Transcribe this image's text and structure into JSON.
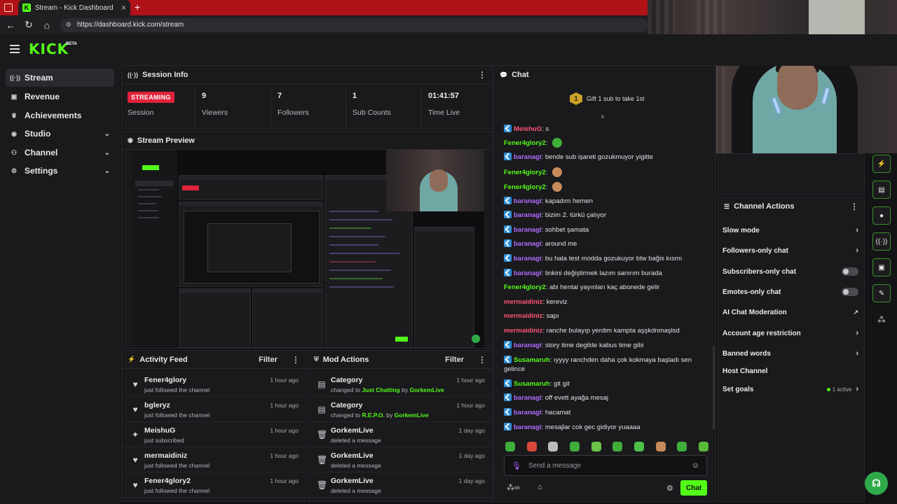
{
  "browser": {
    "tab_title": "Stream - Kick Dashboard",
    "url": "https://dashboard.kick.com/stream",
    "tab_color": "#b01217"
  },
  "brand": {
    "logo": "KICK",
    "beta": "BETA",
    "accent": "#53fc18"
  },
  "sidebar": {
    "items": [
      {
        "label": "Stream",
        "icon": "broadcast-icon",
        "active": true
      },
      {
        "label": "Revenue",
        "icon": "wallet-icon"
      },
      {
        "label": "Achievements",
        "icon": "trophy-icon"
      },
      {
        "label": "Studio",
        "icon": "camera-icon",
        "expandable": true
      },
      {
        "label": "Channel",
        "icon": "users-icon",
        "expandable": true
      },
      {
        "label": "Settings",
        "icon": "gear-icon",
        "expandable": true
      }
    ]
  },
  "session": {
    "title": "Session Info",
    "status": "STREAMING",
    "status_label": "Session",
    "stats": [
      {
        "value": "9",
        "label": "Viewers"
      },
      {
        "value": "7",
        "label": "Followers"
      },
      {
        "value": "1",
        "label": "Sub Counts"
      },
      {
        "value": "01:41:57",
        "label": "Time Live"
      }
    ]
  },
  "preview": {
    "title": "Stream Preview"
  },
  "activity": {
    "title": "Activity Feed",
    "filter": "Filter",
    "items": [
      {
        "name": "Fener4glory",
        "action": "just followed the channel",
        "time": "1 hour ago",
        "icon": "heart-icon"
      },
      {
        "name": "bgleryz",
        "action": "just followed the channel",
        "time": "1 hour ago",
        "icon": "heart-icon"
      },
      {
        "name": "MeishuG",
        "action": "just subscribed",
        "time": "1 hour ago",
        "icon": "sparkle-icon"
      },
      {
        "name": "mermaidiniz",
        "action": "just followed the channel",
        "time": "1 hour ago",
        "icon": "heart-icon"
      },
      {
        "name": "Fener4glory2",
        "action": "just followed the channel",
        "time": "1 hour ago",
        "icon": "heart-icon"
      }
    ]
  },
  "modactions": {
    "title": "Mod Actions",
    "filter": "Filter",
    "items": [
      {
        "name": "Category",
        "pre": "changed to ",
        "v1": "Just Chatting",
        "mid": " by ",
        "v2": "GorkemLive",
        "time": "1 hour ago",
        "icon": "category-icon"
      },
      {
        "name": "Category",
        "pre": "changed to ",
        "v1": "R.E.P.O.",
        "mid": " by ",
        "v2": "GorkemLive",
        "time": "1 hour ago",
        "icon": "category-icon"
      },
      {
        "name": "GorkemLive",
        "pre": "deleted a message",
        "v1": "",
        "mid": "",
        "v2": "",
        "time": "1 day ago",
        "icon": "trash-icon"
      },
      {
        "name": "GorkemLive",
        "pre": "deleted a message",
        "v1": "",
        "mid": "",
        "v2": "",
        "time": "1 day ago",
        "icon": "trash-icon"
      },
      {
        "name": "GorkemLive",
        "pre": "deleted a message",
        "v1": "",
        "mid": "",
        "v2": "",
        "time": "1 day ago",
        "icon": "trash-icon"
      }
    ]
  },
  "chat": {
    "title": "Chat",
    "gift_count": "1",
    "gift_text": "Gift 1 sub to take 1st",
    "placeholder": "Send a message",
    "send_label": "Chat",
    "messages": [
      {
        "user": "MeishuG",
        "color": "#ff5577",
        "badge": true,
        "text": "s"
      },
      {
        "user": "Fener4glory2",
        "color": "#53fc18",
        "badge": false,
        "text": "",
        "emote": "#3fae3a"
      },
      {
        "user": "baranagi",
        "color": "#b06cff",
        "badge": true,
        "text": "bende sub işareti gozukmuyor yigitte"
      },
      {
        "user": "Fener4glory2",
        "color": "#53fc18",
        "badge": false,
        "text": "",
        "emote": "#c98a5a"
      },
      {
        "user": "Fener4glory2",
        "color": "#53fc18",
        "badge": false,
        "text": "",
        "emote": "#c98a5a"
      },
      {
        "user": "baranagi",
        "color": "#b06cff",
        "badge": true,
        "text": "kapadım hemen"
      },
      {
        "user": "baranagi",
        "color": "#b06cff",
        "badge": true,
        "text": "bizim 2. türkü çalıyor"
      },
      {
        "user": "baranagi",
        "color": "#b06cff",
        "badge": true,
        "text": "sohbet şamata"
      },
      {
        "user": "baranagi",
        "color": "#b06cff",
        "badge": true,
        "text": "around me"
      },
      {
        "user": "baranagi",
        "color": "#b06cff",
        "badge": true,
        "text": "bu hala test modda gozukuyor btw bağis kısmı"
      },
      {
        "user": "baranagi",
        "color": "#b06cff",
        "badge": true,
        "text": "linkini değiştirmek lazım sanırım burada"
      },
      {
        "user": "Fener4glory2",
        "color": "#53fc18",
        "badge": false,
        "text": "abi hentai yayınları kaç abonede gelir"
      },
      {
        "user": "mermaidiniz",
        "color": "#ff5577",
        "badge": false,
        "text": "kereviz"
      },
      {
        "user": "mermaidiniz",
        "color": "#ff5577",
        "badge": false,
        "text": "sapı"
      },
      {
        "user": "mermaidiniz",
        "color": "#ff5577",
        "badge": false,
        "text": "ranche bulayıp yerdim kampta aşşkdnmaşlsd"
      },
      {
        "user": "baranagi",
        "color": "#b06cff",
        "badge": true,
        "text": "story time degilde kabus time gibi"
      },
      {
        "user": "Susamaruh",
        "color": "#53fc18",
        "badge": true,
        "text": "ıyyyy ranchden daha çok kokmaya başladı sen gelince"
      },
      {
        "user": "Susamaruh",
        "color": "#53fc18",
        "badge": true,
        "text": "git git"
      },
      {
        "user": "baranagi",
        "color": "#b06cff",
        "badge": true,
        "text": "off evett ayağa mesaj"
      },
      {
        "user": "baranagi",
        "color": "#b06cff",
        "badge": true,
        "text": "hacamat"
      },
      {
        "user": "baranagi",
        "color": "#b06cff",
        "badge": true,
        "text": "mesajlar cok gec gidiyor yuaaaa"
      }
    ]
  },
  "channel_actions": {
    "title": "Channel Actions",
    "items": [
      {
        "label": "Slow mode",
        "control": "chevron"
      },
      {
        "label": "Followers-only chat",
        "control": "chevron"
      },
      {
        "label": "Subscribers-only chat",
        "control": "toggle"
      },
      {
        "label": "Emotes-only chat",
        "control": "toggle"
      },
      {
        "label": "AI Chat Moderation",
        "control": "external"
      },
      {
        "label": "Account age restriction",
        "control": "chevron"
      },
      {
        "label": "Banned words",
        "control": "chevron"
      },
      {
        "label": "Host Channel",
        "control": "none"
      },
      {
        "label": "Set goals",
        "control": "chevron",
        "extra": "1 active"
      }
    ]
  }
}
